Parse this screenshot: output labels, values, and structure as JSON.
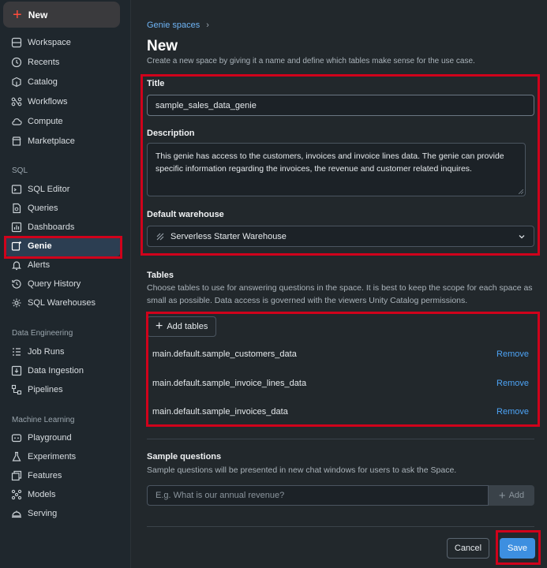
{
  "sidebar": {
    "new_label": "New",
    "items_top": [
      {
        "label": "Workspace",
        "icon": "folder-icon"
      },
      {
        "label": "Recents",
        "icon": "clock-icon"
      },
      {
        "label": "Catalog",
        "icon": "catalog-icon"
      },
      {
        "label": "Workflows",
        "icon": "workflows-icon"
      },
      {
        "label": "Compute",
        "icon": "cloud-icon"
      },
      {
        "label": "Marketplace",
        "icon": "store-icon"
      }
    ],
    "sql_section": "SQL",
    "items_sql": [
      {
        "label": "SQL Editor",
        "icon": "editor-icon"
      },
      {
        "label": "Queries",
        "icon": "queries-icon"
      },
      {
        "label": "Dashboards",
        "icon": "dashboard-icon"
      },
      {
        "label": "Genie",
        "icon": "genie-icon"
      },
      {
        "label": "Alerts",
        "icon": "bell-icon"
      },
      {
        "label": "Query History",
        "icon": "history-icon"
      },
      {
        "label": "SQL Warehouses",
        "icon": "warehouse-icon"
      }
    ],
    "de_section": "Data Engineering",
    "items_de": [
      {
        "label": "Job Runs",
        "icon": "job-runs-icon"
      },
      {
        "label": "Data Ingestion",
        "icon": "ingestion-icon"
      },
      {
        "label": "Pipelines",
        "icon": "pipelines-icon"
      }
    ],
    "ml_section": "Machine Learning",
    "items_ml": [
      {
        "label": "Playground",
        "icon": "playground-icon"
      },
      {
        "label": "Experiments",
        "icon": "flask-icon"
      },
      {
        "label": "Features",
        "icon": "features-icon"
      },
      {
        "label": "Models",
        "icon": "models-icon"
      },
      {
        "label": "Serving",
        "icon": "serving-icon"
      }
    ],
    "active_item": "Genie"
  },
  "breadcrumb": {
    "parent": "Genie spaces",
    "separator": "›"
  },
  "page": {
    "title": "New",
    "subtitle": "Create a new space by giving it a name and define which tables make sense for the use case."
  },
  "form": {
    "title_label": "Title",
    "title_value": "sample_sales_data_genie",
    "description_label": "Description",
    "description_value": "This genie has access to the customers, invoices and invoice lines data. The genie can provide specific information regarding the invoices, the revenue and customer related inquires.",
    "warehouse_label": "Default warehouse",
    "warehouse_value": "Serverless Starter Warehouse"
  },
  "tables": {
    "label": "Tables",
    "help": "Choose tables to use for answering questions in the space. It is best to keep the scope for each space as small as possible. Data access is governed with the viewers Unity Catalog permissions.",
    "add_label": "Add tables",
    "items": [
      {
        "name": "main.default.sample_customers_data",
        "action": "Remove"
      },
      {
        "name": "main.default.sample_invoice_lines_data",
        "action": "Remove"
      },
      {
        "name": "main.default.sample_invoices_data",
        "action": "Remove"
      }
    ]
  },
  "sample_questions": {
    "label": "Sample questions",
    "help": "Sample questions will be presented in new chat windows for users to ask the Space.",
    "placeholder": "E.g. What is our annual revenue?",
    "add_label": "Add"
  },
  "footer": {
    "cancel_label": "Cancel",
    "save_label": "Save"
  },
  "colors": {
    "accent": "#3d8fe0",
    "highlight": "#d0021b",
    "link": "#4da3f5"
  }
}
